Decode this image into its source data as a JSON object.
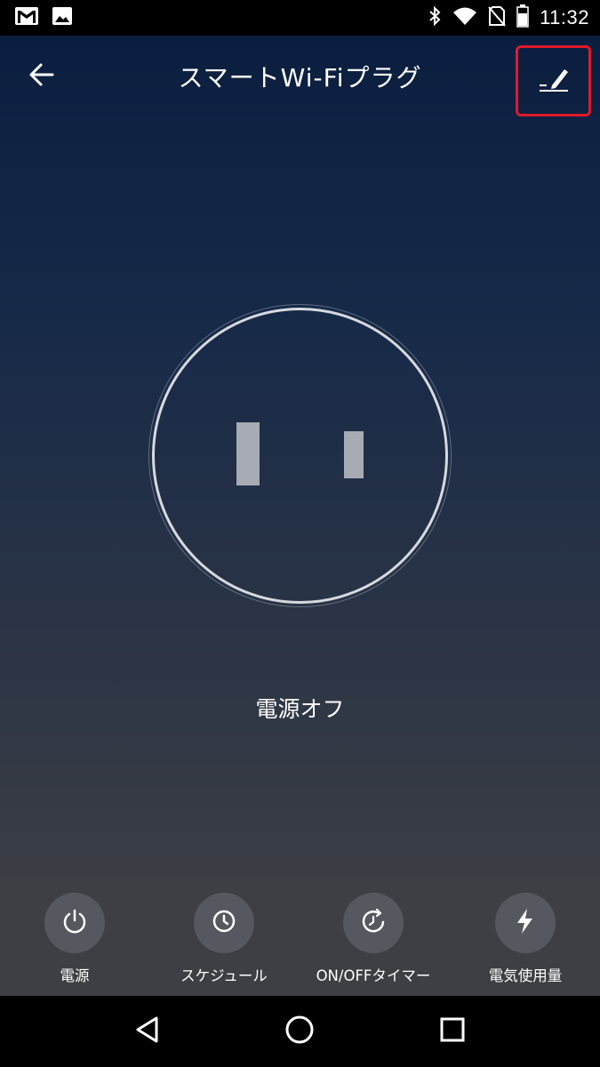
{
  "status_bar": {
    "time": "11:32",
    "left_icons": [
      "gmail-icon",
      "image-icon"
    ],
    "right_icons": [
      "bluetooth-icon",
      "wifi-icon",
      "no-sim-icon",
      "battery-icon"
    ]
  },
  "header": {
    "title": "スマートWi-Fiプラグ",
    "back_icon": "arrow-left-icon",
    "edit_icon": "pencil-edit-icon",
    "highlight_color": "#e0192a"
  },
  "plug": {
    "status_text": "電源オフ",
    "state": "off"
  },
  "actions": [
    {
      "label": "電源",
      "icon": "power-icon"
    },
    {
      "label": "スケジュール",
      "icon": "clock-icon"
    },
    {
      "label": "ON/OFFタイマー",
      "icon": "timer-icon"
    },
    {
      "label": "電気使用量",
      "icon": "lightning-icon"
    }
  ],
  "nav_bar": {
    "buttons": [
      "back-triangle-icon",
      "home-circle-icon",
      "recents-square-icon"
    ]
  },
  "colors": {
    "gradient_top": "#0b1e3f",
    "gradient_bottom": "#3a3d43",
    "bottom_bar": "#3d3f44",
    "action_circle": "#55585e"
  }
}
